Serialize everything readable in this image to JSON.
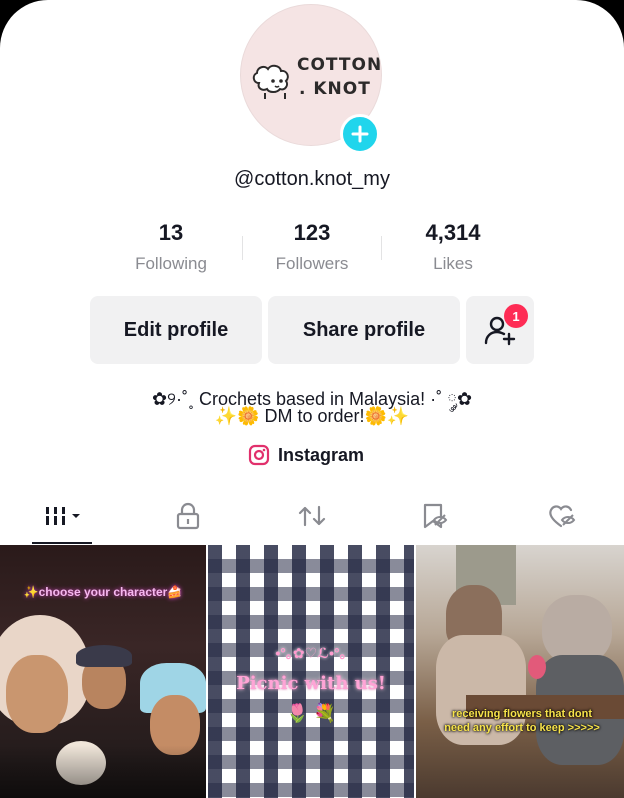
{
  "profile": {
    "logo_line1": "COTTON",
    "logo_line2": ". KNOT",
    "username": "@cotton.knot_my"
  },
  "stats": {
    "following": {
      "value": "13",
      "label": "Following"
    },
    "followers": {
      "value": "123",
      "label": "Followers"
    },
    "likes": {
      "value": "4,314",
      "label": "Likes"
    }
  },
  "actions": {
    "edit_label": "Edit profile",
    "share_label": "Share profile",
    "friends_badge": "1"
  },
  "bio": {
    "line1": "✿୨·˚˳ Crochets based in Malaysia! ·˚ ༘✿",
    "line2": "✨🌼 DM to order!🌼✨",
    "link_label": "Instagram"
  },
  "tabs": [
    "videos-tab",
    "private-tab",
    "reposts-tab",
    "saved-tab",
    "liked-tab"
  ],
  "videos": [
    {
      "caption": "✨choose your character🍰"
    },
    {
      "caption_top": "•°｡✿♡ℒ•°｡",
      "caption": "Picnic with us!",
      "caption_emoji": "🌷 💐"
    },
    {
      "caption": "receiving flowers that dont need any effort to keep >>>>>"
    }
  ],
  "colors": {
    "accent_cyan": "#20d5ec",
    "badge_red": "#fe2c55",
    "button_bg": "#f1f1f2",
    "secondary_text": "#8a8b91"
  }
}
